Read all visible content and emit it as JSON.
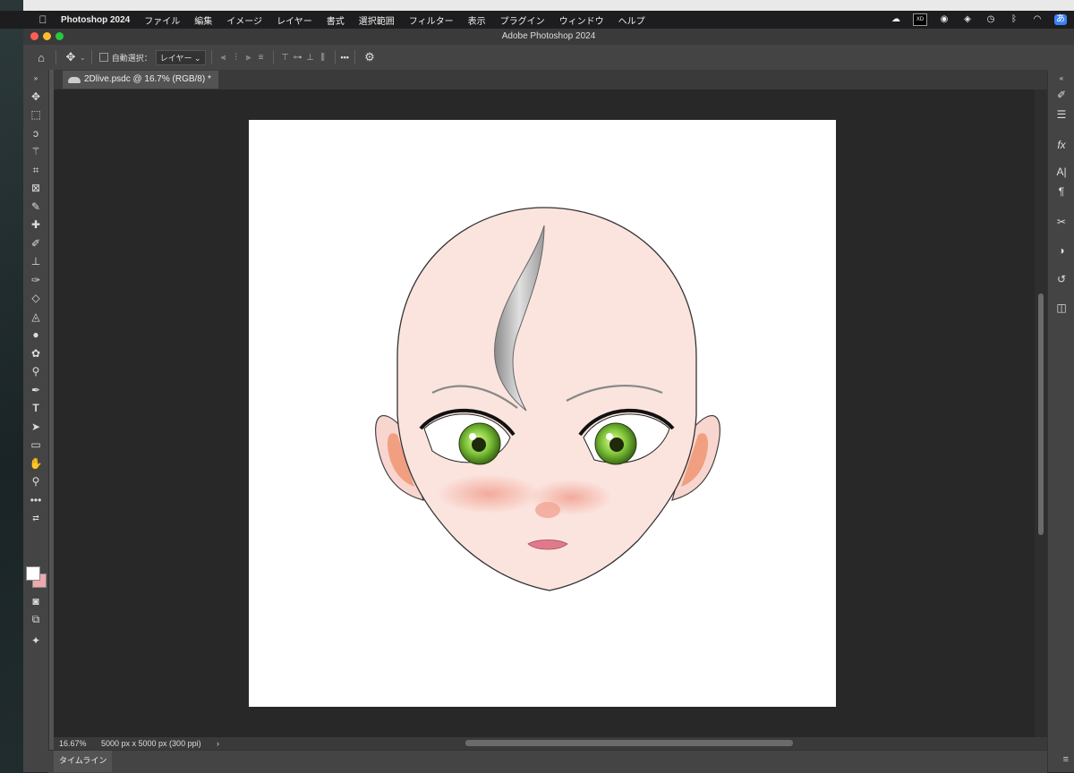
{
  "menubar": {
    "app_name": "Photoshop 2024",
    "items": [
      "ファイル",
      "編集",
      "イメージ",
      "レイヤー",
      "書式",
      "選択範囲",
      "フィルター",
      "表示",
      "プラグイン",
      "ウィンドウ",
      "ヘルプ"
    ],
    "status_icons": [
      "creative-cloud-icon",
      "xd-icon",
      "color-wheel-icon",
      "layers-icon",
      "time-machine-icon",
      "bluetooth-icon",
      "wifi-icon",
      "input-method-icon"
    ],
    "input_method_label": "あ"
  },
  "window": {
    "title": "Adobe Photoshop 2024"
  },
  "options_bar": {
    "auto_select_label": "自動選択：",
    "auto_select_value": "レイヤー",
    "more_label": "•••"
  },
  "document": {
    "tab_label": "2Dlive.psdc @ 16.7% (RGB/8) *"
  },
  "status": {
    "zoom": "16.67%",
    "dimensions": "5000 px x 5000 px (300 ppi)",
    "arrow": "›"
  },
  "timeline": {
    "label": "タイムライン"
  },
  "colors": {
    "foreground": "#ffffff",
    "background": "#f0a8ac",
    "skin": "#f9e1dc",
    "iris": "#7fc43a"
  }
}
